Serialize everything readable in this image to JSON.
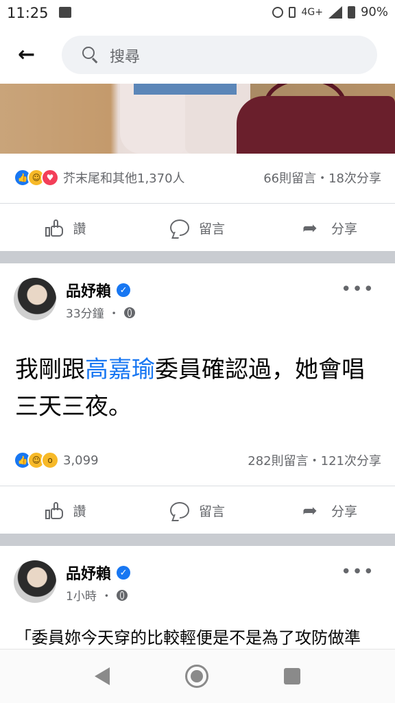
{
  "status_bar": {
    "time": "11:25",
    "network": "4G+",
    "battery": "90%"
  },
  "search": {
    "placeholder": "搜尋"
  },
  "post1": {
    "reaction_summary": "芥末尾和其他1,370人",
    "comments": "66則留言",
    "separator": "・",
    "shares": "18次分享"
  },
  "actions": {
    "like": "讚",
    "comment": "留言",
    "share": "分享"
  },
  "post2": {
    "author": "品妤賴",
    "time": "33分鐘",
    "dot": "・",
    "text_before": "我剛跟",
    "mention": "高嘉瑜",
    "text_after": "委員確認過，她會唱三天三夜。",
    "reaction_count": "3,099",
    "comments": "282則留言",
    "separator": "・",
    "shares": "121次分享"
  },
  "post3": {
    "author": "品妤賴",
    "time": "1小時",
    "dot": "・",
    "text": "「委員妳今天穿的比較輕便是不是為了攻防做準"
  },
  "colors": {
    "accent": "#1877f2",
    "divider": "#c9ccd1",
    "muted": "#65676b"
  }
}
